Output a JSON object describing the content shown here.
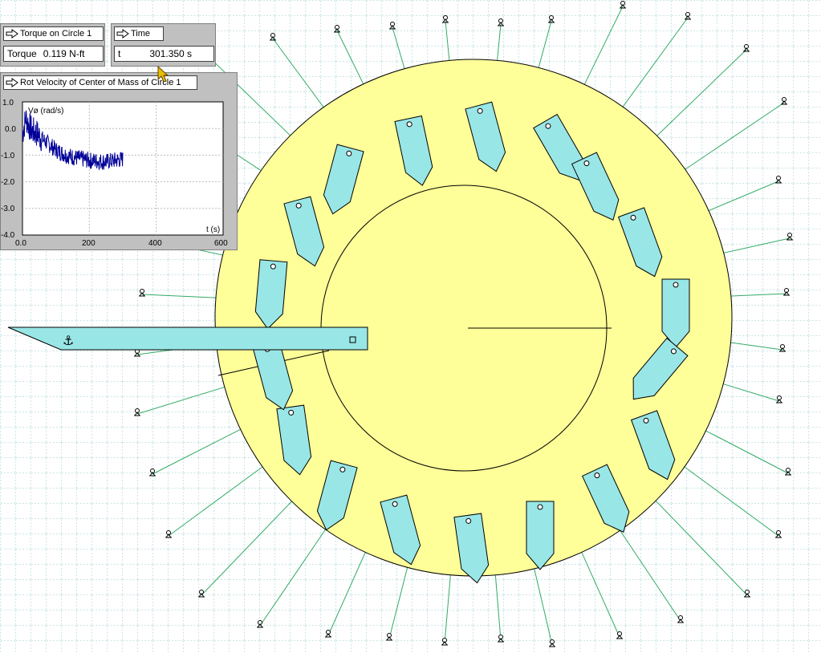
{
  "torque_meter": {
    "title": "Torque on Circle 1",
    "label": "Torque",
    "value": "0.119 N-ft"
  },
  "time_meter": {
    "title": "Time",
    "label": "t",
    "value": "301.350 s"
  },
  "graph": {
    "title": "Rot Velocity of Center of Mass of Circle 1",
    "ylabel": "Vø (rad/s)",
    "xlabel": "t (s)",
    "y_ticks": [
      "1.0",
      "0.0",
      "-1.0",
      "-2.0",
      "-3.0",
      "-4.0"
    ],
    "x_ticks": [
      "0.0",
      "200",
      "400",
      "600"
    ]
  },
  "chart_data": {
    "type": "line",
    "title": "Rot Velocity of Center of Mass of Circle 1",
    "xlabel": "t (s)",
    "ylabel": "Vø (rad/s)",
    "xlim": [
      0,
      600
    ],
    "ylim": [
      -4.0,
      1.0
    ],
    "x": [
      0,
      10,
      20,
      30,
      45,
      60,
      80,
      100,
      130,
      160,
      200,
      250,
      300
    ],
    "series": [
      {
        "values": [
          -0.2,
          0.4,
          0.1,
          -0.1,
          -0.2,
          -0.4,
          -0.6,
          -0.8,
          -1.0,
          -1.1,
          -1.2,
          -1.25,
          -1.15
        ]
      }
    ]
  },
  "colors": {
    "wheel": "#ffff99",
    "bucket": "#99e6e6",
    "grid": "#99cccc",
    "rope": "#33aa66",
    "plot": "#000099"
  }
}
